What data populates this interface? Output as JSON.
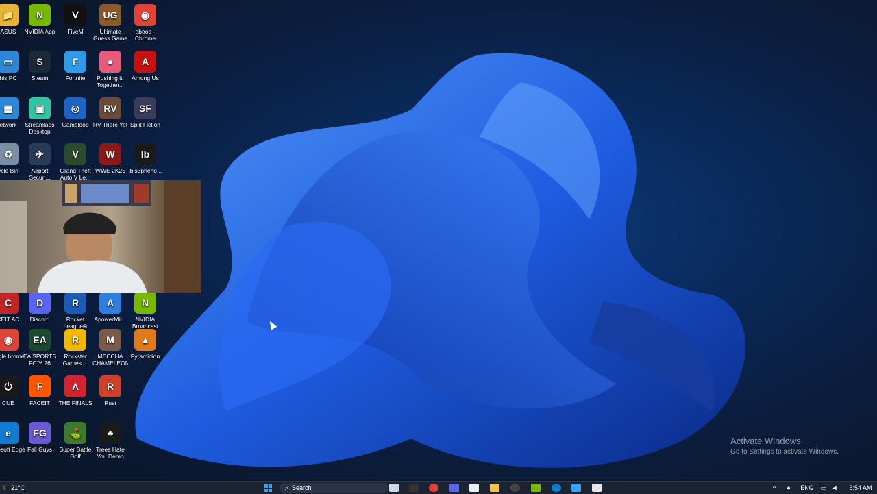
{
  "desktop": {
    "icons": [
      {
        "label": "ASUS",
        "glyph": "📁",
        "color": "#e8b339"
      },
      {
        "label": "NVIDIA App",
        "glyph": "N",
        "color": "#76b900"
      },
      {
        "label": "FiveM",
        "glyph": "Ⅴ",
        "color": "#111"
      },
      {
        "label": "Ultimate Guess Game",
        "glyph": "UG",
        "color": "#8a5a2b"
      },
      {
        "label": "abood - Chrome",
        "glyph": "◉",
        "color": "#db4437"
      },
      {
        "label": "his PC",
        "glyph": "▭",
        "color": "#2b88d8"
      },
      {
        "label": "Steam",
        "glyph": "S",
        "color": "#1b2838"
      },
      {
        "label": "Fortnite",
        "glyph": "F",
        "color": "#2f9be8"
      },
      {
        "label": "Pushing it! Together...",
        "glyph": "●",
        "color": "#e65a7a"
      },
      {
        "label": "Among Us",
        "glyph": "A",
        "color": "#c51111"
      },
      {
        "label": "etwork",
        "glyph": "▦",
        "color": "#2b88d8"
      },
      {
        "label": "Streamlabs Desktop",
        "glyph": "▣",
        "color": "#31c3a2"
      },
      {
        "label": "Gameloop",
        "glyph": "◎",
        "color": "#1e63c6"
      },
      {
        "label": "RV There Yet",
        "glyph": "RV",
        "color": "#6b4a3a"
      },
      {
        "label": "Split Fiction",
        "glyph": "SF",
        "color": "#3b3b5a"
      },
      {
        "label": "ycle Bin",
        "glyph": "♻",
        "color": "#7a8ea6"
      },
      {
        "label": "Airport Securi...",
        "glyph": "✈",
        "color": "#2a3b5a"
      },
      {
        "label": "Grand Theft Auto V Le...",
        "glyph": "V",
        "color": "#2c4a2c"
      },
      {
        "label": "WWE 2K25",
        "glyph": "W",
        "color": "#8a1a1a"
      },
      {
        "label": "ibis3pheno...",
        "glyph": "Ib",
        "color": "#1a1a1a"
      },
      {
        "label": "CEIT AC",
        "glyph": "C",
        "color": "#c02626"
      },
      {
        "label": "Discord",
        "glyph": "D",
        "color": "#5865f2"
      },
      {
        "label": "Rocket League®",
        "glyph": "R",
        "color": "#1c5bb5"
      },
      {
        "label": "ApowerMir...",
        "glyph": "A",
        "color": "#2f7fe0"
      },
      {
        "label": "NVIDIA Broadcast",
        "glyph": "N",
        "color": "#76b900"
      },
      {
        "label": "oogle hrome",
        "glyph": "◉",
        "color": "#db4437"
      },
      {
        "label": "EA SPORTS FC™ 26",
        "glyph": "EA",
        "color": "#1d4a2f"
      },
      {
        "label": "Rockstar Games ...",
        "glyph": "R",
        "color": "#f2b705"
      },
      {
        "label": "MECCHA CHAMELEON",
        "glyph": "M",
        "color": "#7a5a4a"
      },
      {
        "label": "Pyramidion",
        "glyph": "▲",
        "color": "#e07a1f"
      },
      {
        "label": "CUE",
        "glyph": "⏻",
        "color": "#1a1a1a"
      },
      {
        "label": "FACEIT",
        "glyph": "F",
        "color": "#ff5500"
      },
      {
        "label": "THE FINALS",
        "glyph": "Λ",
        "color": "#d1242f"
      },
      {
        "label": "Rust",
        "glyph": "R",
        "color": "#ce422b"
      },
      {
        "label": "icrosoft Edge",
        "glyph": "e",
        "color": "#0f7bd1"
      },
      {
        "label": "Fall Guys",
        "glyph": "FG",
        "color": "#6a5ad6"
      },
      {
        "label": "Super Battle Golf",
        "glyph": "⛳",
        "color": "#3c7a2c"
      },
      {
        "label": "Trees Hate You Demo",
        "glyph": "♣",
        "color": "#1a1a1a"
      }
    ]
  },
  "watermark": {
    "title": "Activate Windows",
    "subtitle": "Go to Settings to activate Windows."
  },
  "taskbar": {
    "weather_temp": "21°C",
    "search_label": "Search",
    "language": "ENG",
    "clock_time": "5:54 AM"
  }
}
